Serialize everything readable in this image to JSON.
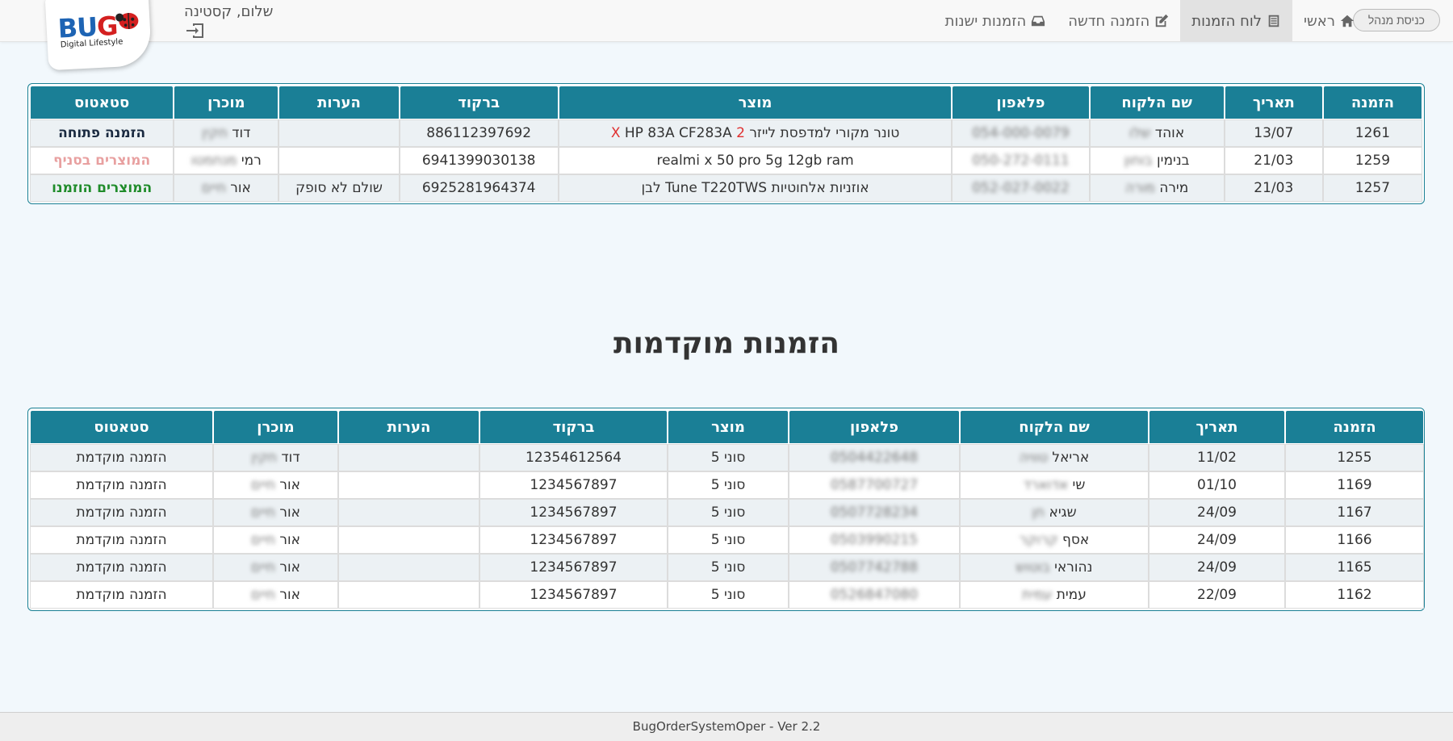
{
  "navbar": {
    "admin_label": "כניסת מנהל",
    "items": [
      {
        "label": "ראשי",
        "icon": "home-icon"
      },
      {
        "label": "לוח הזמנות",
        "icon": "list-icon"
      },
      {
        "label": "הזמנה חדשה",
        "icon": "edit-icon"
      },
      {
        "label": "הזמנות ישנות",
        "icon": "inbox-icon"
      }
    ],
    "greeting": "שלום, קסטינה",
    "logo_text": "BUG",
    "logo_tagline": "Digital Lifestyle"
  },
  "orders_table": {
    "headers": [
      "הזמנה",
      "תאריך",
      "שם הלקוח",
      "פלאפון",
      "מוצר",
      "ברקוד",
      "הערות",
      "מוכרן",
      "סטאטוס"
    ],
    "rows": [
      {
        "order": "1261",
        "date": "13/07",
        "customer_first": "אוהד",
        "customer_last": "שלו",
        "phone": "054-000-0079",
        "product_pre": "טונר מקורי למדפסת לייזר ",
        "product_mid": "2 X",
        "product_post": " HP 83A CF283A",
        "barcode": "886112397692",
        "notes": "",
        "seller_first": "דוד",
        "seller_last": "חקין",
        "status": "הזמנה פתוחה",
        "status_class": "st-open"
      },
      {
        "order": "1259",
        "date": "21/03",
        "customer_first": "בנימין",
        "customer_last": "בוחון",
        "phone": "050-272-0111",
        "product_pre": "realmi x 50 pro 5g 12gb ram",
        "product_mid": "",
        "product_post": "",
        "barcode": "6941399030138",
        "notes": "",
        "seller_first": "רמי",
        "seller_last": "מנחמטו",
        "status": "המוצרים בסניף",
        "status_class": "st-branch"
      },
      {
        "order": "1257",
        "date": "21/03",
        "customer_first": "מירה",
        "customer_last": "מורה",
        "phone": "052-027-0022",
        "product_pre": "אוזניות אלחוטיות Tune T220TWS לבן",
        "product_mid": "",
        "product_post": "",
        "barcode": "6925281964374",
        "notes": "שולם לא סופק",
        "seller_first": "אור",
        "seller_last": "חיים",
        "status": "המוצרים הוזמנו",
        "status_class": "st-ordered"
      }
    ]
  },
  "preorders_title": "הזמנות מוקדמות",
  "preorders_table": {
    "headers": [
      "הזמנה",
      "תאריך",
      "שם הלקוח",
      "פלאפון",
      "מוצר",
      "ברקוד",
      "הערות",
      "מוכרן",
      "סטאטוס"
    ],
    "rows": [
      {
        "order": "1255",
        "date": "11/02",
        "customer_first": "אריאל",
        "customer_last": "טוויה",
        "phone": "0504422648",
        "product": "סוני 5",
        "barcode": "12354612564",
        "notes": "",
        "seller_first": "דוד",
        "seller_last": "חקין",
        "status": "הזמנה מוקדמת"
      },
      {
        "order": "1169",
        "date": "01/10",
        "customer_first": "שי",
        "customer_last": "אדוארד",
        "phone": "0587700727",
        "product": "סוני 5",
        "barcode": "1234567897",
        "notes": "",
        "seller_first": "אור",
        "seller_last": "חיים",
        "status": "הזמנה מוקדמת"
      },
      {
        "order": "1167",
        "date": "24/09",
        "customer_first": "שגיא",
        "customer_last": "חן",
        "phone": "0507728234",
        "product": "סוני 5",
        "barcode": "1234567897",
        "notes": "",
        "seller_first": "אור",
        "seller_last": "חיים",
        "status": "הזמנה מוקדמת"
      },
      {
        "order": "1166",
        "date": "24/09",
        "customer_first": "אסף",
        "customer_last": "קרוקר",
        "phone": "0503990215",
        "product": "סוני 5",
        "barcode": "1234567897",
        "notes": "",
        "seller_first": "אור",
        "seller_last": "חיים",
        "status": "הזמנה מוקדמת"
      },
      {
        "order": "1165",
        "date": "24/09",
        "customer_first": "נהוראי",
        "customer_last": "בוטוש",
        "phone": "0507742788",
        "product": "סוני 5",
        "barcode": "1234567897",
        "notes": "",
        "seller_first": "אור",
        "seller_last": "חיים",
        "status": "הזמנה מוקדמת"
      },
      {
        "order": "1162",
        "date": "22/09",
        "customer_first": "עמית",
        "customer_last": "עמית",
        "phone": "0526847080",
        "product": "סוני 5",
        "barcode": "1234567897",
        "notes": "",
        "seller_first": "אור",
        "seller_last": "חיים",
        "status": "הזמנה מוקדמת"
      }
    ]
  },
  "footer": {
    "text": "BugOrderSystemOper - Ver 2.2"
  },
  "colors": {
    "header_teal": "#1a7f96",
    "status_open": "#1a2a40",
    "status_branch": "#e8a0a0",
    "status_ordered": "#1f8c2a"
  }
}
